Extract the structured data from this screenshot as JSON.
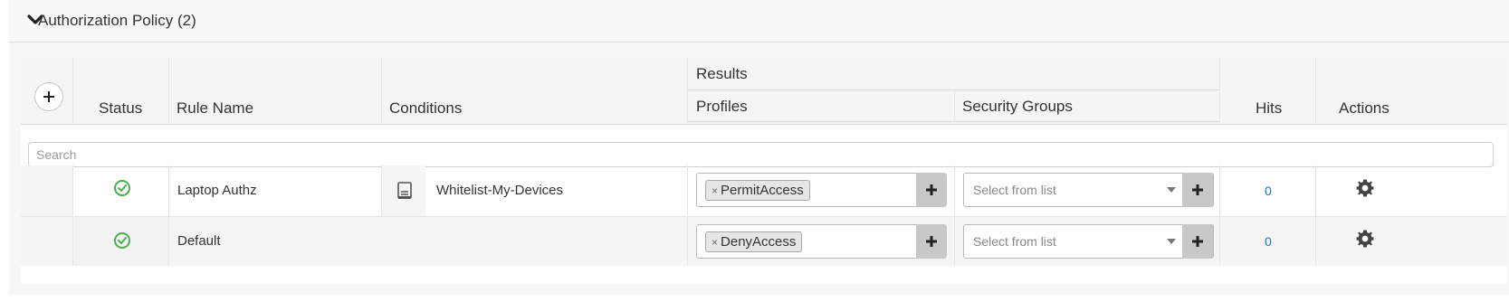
{
  "section": {
    "title": "Authorization Policy (2)"
  },
  "headers": {
    "status": "Status",
    "rule_name": "Rule Name",
    "conditions": "Conditions",
    "results": "Results",
    "profiles": "Profiles",
    "security_groups": "Security Groups",
    "hits": "Hits",
    "actions": "Actions"
  },
  "search": {
    "placeholder": "Search"
  },
  "rules": [
    {
      "status": "enabled",
      "name": "Laptop Authz",
      "condition": "Whitelist-My-Devices",
      "condition_icon": "library-condition-icon",
      "profile_tag": "PermitAccess",
      "tag_remove": "×",
      "security_group_placeholder": "Select from list",
      "hits": "0"
    },
    {
      "status": "enabled",
      "name": "Default",
      "condition": "",
      "profile_tag": "DenyAccess",
      "tag_remove": "×",
      "security_group_placeholder": "Select from list",
      "hits": "0"
    }
  ],
  "colors": {
    "status_ok": "#4cae4c",
    "hits_link": "#1a73c4",
    "plus_button": "#c8c8c8"
  }
}
